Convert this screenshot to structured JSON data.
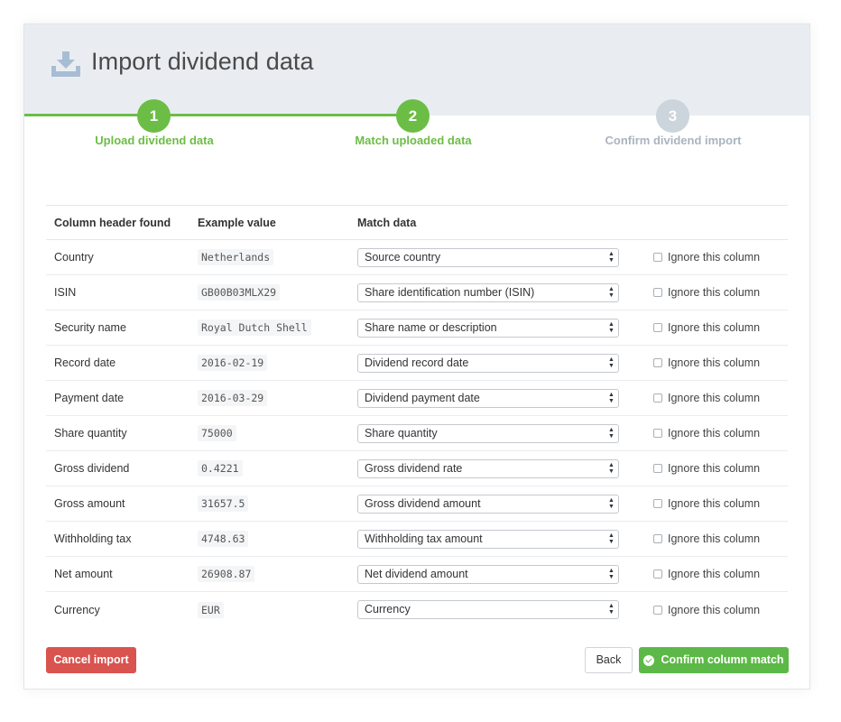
{
  "header": {
    "title": "Import dividend data"
  },
  "stepper": {
    "steps": [
      {
        "number": "1",
        "label": "Upload dividend data"
      },
      {
        "number": "2",
        "label": "Match uploaded data"
      },
      {
        "number": "3",
        "label": "Confirm dividend import"
      }
    ],
    "current_step": 2
  },
  "table": {
    "headers": [
      "Column header found",
      "Example value",
      "Match data"
    ],
    "rows": [
      {
        "column": "Country",
        "example": "Netherlands",
        "match": "Source country",
        "ignore_label": "Ignore this column"
      },
      {
        "column": "ISIN",
        "example": "GB00B03MLX29",
        "match": "Share identification number (ISIN)",
        "ignore_label": "Ignore this column"
      },
      {
        "column": "Security name",
        "example": "Royal Dutch Shell",
        "match": "Share name or description",
        "ignore_label": "Ignore this column"
      },
      {
        "column": "Record date",
        "example": "2016-02-19",
        "match": "Dividend record date",
        "ignore_label": "Ignore this column"
      },
      {
        "column": "Payment date",
        "example": "2016-03-29",
        "match": "Dividend payment date",
        "ignore_label": "Ignore this column"
      },
      {
        "column": "Share quantity",
        "example": "75000",
        "match": "Share quantity",
        "ignore_label": "Ignore this column"
      },
      {
        "column": "Gross dividend",
        "example": "0.4221",
        "match": "Gross dividend rate",
        "ignore_label": "Ignore this column"
      },
      {
        "column": "Gross amount",
        "example": "31657.5",
        "match": "Gross dividend amount",
        "ignore_label": "Ignore this column"
      },
      {
        "column": "Withholding tax",
        "example": "4748.63",
        "match": "Withholding tax amount",
        "ignore_label": "Ignore this column"
      },
      {
        "column": "Net amount",
        "example": "26908.87",
        "match": "Net dividend amount",
        "ignore_label": "Ignore this column"
      },
      {
        "column": "Currency",
        "example": "EUR",
        "match": "Currency",
        "ignore_label": "Ignore this column"
      }
    ]
  },
  "actions": {
    "cancel_label": "Cancel import",
    "back_label": "Back",
    "confirm_label": "Confirm column match"
  },
  "colors": {
    "accent_green": "#6cbd45",
    "danger_red": "#d9534f",
    "inactive_gray": "#ccd4dc",
    "header_bg": "#e9edf2"
  },
  "icons": {
    "header": "download-tray-icon",
    "confirm": "check-circle-icon",
    "select": "select-arrows-icon"
  }
}
